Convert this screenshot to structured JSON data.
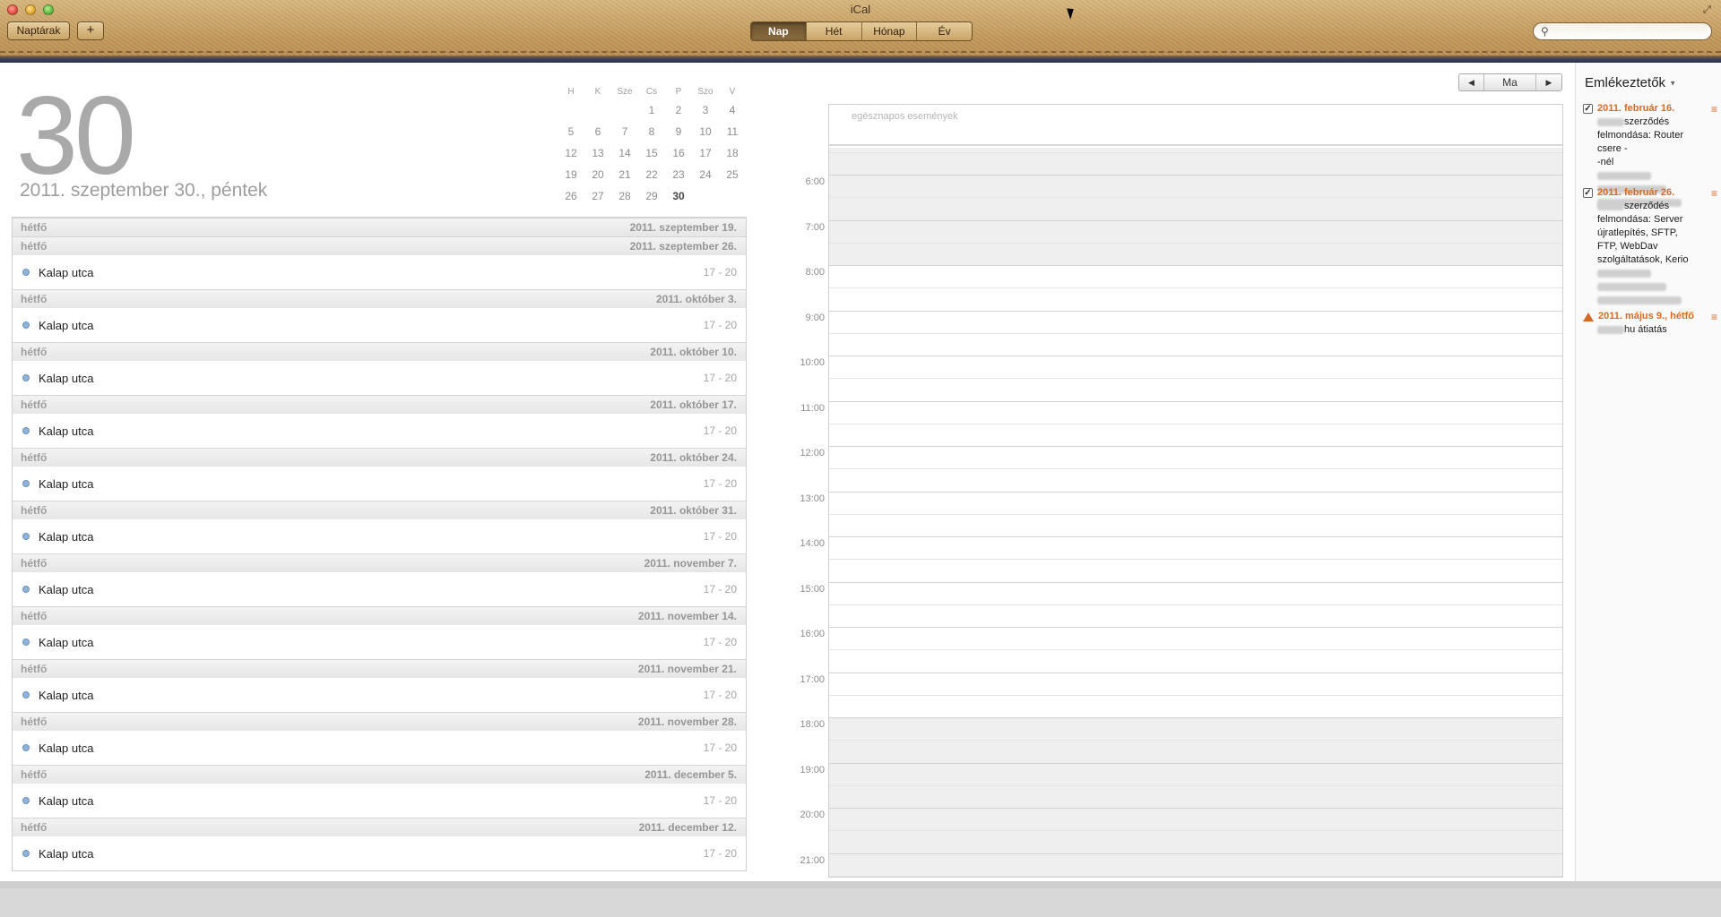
{
  "window": {
    "title": "iCal"
  },
  "toolbar": {
    "calendars_label": "Naptárak",
    "add_label": "+",
    "views": [
      "Nap",
      "Hét",
      "Hónap",
      "Év"
    ],
    "active_view": "Nap",
    "search_placeholder": ""
  },
  "day": {
    "number": "30",
    "long_date": "2011. szeptember 30., péntek"
  },
  "mini_calendar": {
    "headers": [
      "H",
      "K",
      "Sze",
      "Cs",
      "P",
      "Szo",
      "V"
    ],
    "weeks": [
      [
        "",
        "",
        "",
        "1",
        "2",
        "3",
        "4"
      ],
      [
        "5",
        "6",
        "7",
        "8",
        "9",
        "10",
        "11"
      ],
      [
        "12",
        "13",
        "14",
        "15",
        "16",
        "17",
        "18"
      ],
      [
        "19",
        "20",
        "21",
        "22",
        "23",
        "24",
        "25"
      ],
      [
        "26",
        "27",
        "28",
        "29",
        "30",
        "",
        ""
      ]
    ],
    "today": "30"
  },
  "event_list": {
    "groups": [
      {
        "weekday": "hétfő",
        "date": "2011. szeptember 19.",
        "events": []
      },
      {
        "weekday": "hétfő",
        "date": "2011. szeptember 26.",
        "events": [
          {
            "name": "Kalap utca",
            "time": "17 - 20"
          }
        ]
      },
      {
        "weekday": "hétfő",
        "date": "2011. október 3.",
        "events": [
          {
            "name": "Kalap utca",
            "time": "17 - 20"
          }
        ]
      },
      {
        "weekday": "hétfő",
        "date": "2011. október 10.",
        "events": [
          {
            "name": "Kalap utca",
            "time": "17 - 20"
          }
        ]
      },
      {
        "weekday": "hétfő",
        "date": "2011. október 17.",
        "events": [
          {
            "name": "Kalap utca",
            "time": "17 - 20"
          }
        ]
      },
      {
        "weekday": "hétfő",
        "date": "2011. október 24.",
        "events": [
          {
            "name": "Kalap utca",
            "time": "17 - 20"
          }
        ]
      },
      {
        "weekday": "hétfő",
        "date": "2011. október 31.",
        "events": [
          {
            "name": "Kalap utca",
            "time": "17 - 20"
          }
        ]
      },
      {
        "weekday": "hétfő",
        "date": "2011. november 7.",
        "events": [
          {
            "name": "Kalap utca",
            "time": "17 - 20"
          }
        ]
      },
      {
        "weekday": "hétfő",
        "date": "2011. november 14.",
        "events": [
          {
            "name": "Kalap utca",
            "time": "17 - 20"
          }
        ]
      },
      {
        "weekday": "hétfő",
        "date": "2011. november 21.",
        "events": [
          {
            "name": "Kalap utca",
            "time": "17 - 20"
          }
        ]
      },
      {
        "weekday": "hétfő",
        "date": "2011. november 28.",
        "events": [
          {
            "name": "Kalap utca",
            "time": "17 - 20"
          }
        ]
      },
      {
        "weekday": "hétfő",
        "date": "2011. december 5.",
        "events": [
          {
            "name": "Kalap utca",
            "time": "17 - 20"
          }
        ]
      },
      {
        "weekday": "hétfő",
        "date": "2011. december 12.",
        "events": [
          {
            "name": "Kalap utca",
            "time": "17 - 20"
          }
        ]
      }
    ]
  },
  "day_view": {
    "nav": {
      "prev": "◀",
      "today": "Ma",
      "next": "▶"
    },
    "all_day_label": "egésznapos események",
    "hours": [
      "6:00",
      "7:00",
      "8:00",
      "9:00",
      "10:00",
      "11:00",
      "12:00",
      "13:00",
      "14:00",
      "15:00",
      "16:00",
      "17:00",
      "18:00",
      "19:00",
      "20:00",
      "21:00"
    ]
  },
  "reminders": {
    "title": "Emlékeztetők",
    "items": [
      {
        "status": "done",
        "date": "2011. február 16.",
        "lines": [
          "szerződés",
          "felmondása: Router",
          "csere - ",
          "-nél"
        ]
      },
      {
        "status": "done",
        "date": "2011. február 26.",
        "lines": [
          "szerződés",
          "felmondása: Server",
          "újratlepítés, SFTP,",
          "FTP, WebDav",
          "szolgáltatások, Kerio"
        ]
      },
      {
        "status": "overdue",
        "date": "2011. május 9., hétfő",
        "lines": [
          "hu átiatás"
        ]
      }
    ]
  },
  "colors": {
    "reminder_accent": "#d66a24",
    "event_dot": "#8fb3d9"
  },
  "icons": [
    "close-icon",
    "minimize-icon",
    "zoom-icon",
    "fullscreen-icon",
    "search-icon",
    "checkbox-icon",
    "warning-icon",
    "priority-icon"
  ]
}
